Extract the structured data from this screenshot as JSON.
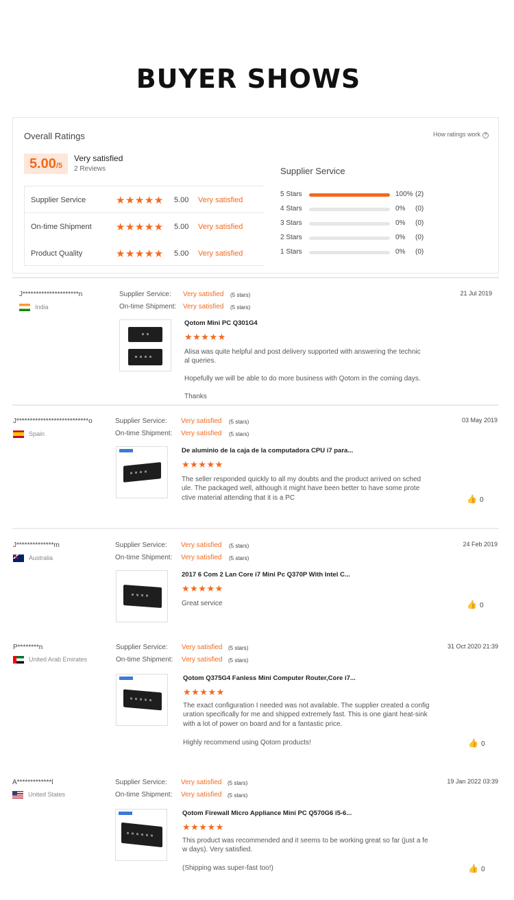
{
  "page": {
    "title": "BUYER SHOWS"
  },
  "summary": {
    "header": "Overall Ratings",
    "how_ratings_work": "How ratings work",
    "help_glyph": "?",
    "score": "5.00",
    "score_max": "/5",
    "rating_text": "Very satisfied",
    "reviews_count": "2 Reviews",
    "categories": [
      {
        "name": "Supplier Service",
        "stars": "★★★★★",
        "value": "5.00",
        "text": "Very satisfied"
      },
      {
        "name": "On-time Shipment",
        "stars": "★★★★★",
        "value": "5.00",
        "text": "Very satisfied"
      },
      {
        "name": "Product Quality",
        "stars": "★★★★★",
        "value": "5.00",
        "text": "Very satisfied"
      }
    ],
    "breakdown_title": "Supplier Service",
    "breakdown": [
      {
        "label": "5 Stars",
        "fraction": 1.0,
        "percent": "100%",
        "count": "(2)"
      },
      {
        "label": "4 Stars",
        "fraction": 0.0,
        "percent": "0%",
        "count": "(0)"
      },
      {
        "label": "3 Stars",
        "fraction": 0.0,
        "percent": "0%",
        "count": "(0)"
      },
      {
        "label": "2 Stars",
        "fraction": 0.0,
        "percent": "0%",
        "count": "(0)"
      },
      {
        "label": "1 Stars",
        "fraction": 0.0,
        "percent": "0%",
        "count": "(0)"
      }
    ],
    "accent_color": "#f26a1e"
  },
  "review_labels": {
    "supplier": "Supplier Service:",
    "shipment": "On-time Shipment:"
  },
  "reviews": [
    {
      "user": "J*********************n",
      "country": "India",
      "flag": "flag-india",
      "supplier_value": "Very satisfied",
      "supplier_stars": "(5 stars)",
      "shipment_value": "Very satisfied",
      "shipment_stars": "(5 stars)",
      "date": "21 Jul 2019",
      "product": "Qotom Mini PC Q301G4",
      "stars": "★★★★★",
      "text1": "Alisa was quite helpful and post delivery supported with answering the technic",
      "text2": "al queries.",
      "text3": "Hopefully we will be able to do more business with Qotom in the coming days.",
      "text4": "Thanks",
      "likes": ""
    },
    {
      "user": "J***************************o",
      "country": "Spain",
      "flag": "flag-spain",
      "supplier_value": "Very satisfied",
      "supplier_stars": "(5 stars)",
      "shipment_value": "Very satisfied",
      "shipment_stars": "(5 stars)",
      "date": "03 May 2019",
      "product": "De aluminio de la caja de la computadora CPU i7 para...",
      "stars": "★★★★★",
      "text1": "The seller responded quickly to all my doubts and the product arrived on sched",
      "text2": "ule. The packaged well, although it might have been better to have some prote",
      "text3": "ctive material attending that it is a PC",
      "likes": "0"
    },
    {
      "user": "J**************m",
      "country": "Australia",
      "flag": "flag-australia",
      "supplier_value": "Very satisfied",
      "supplier_stars": "(5 stars)",
      "shipment_value": "Very satisfied",
      "shipment_stars": "(5 stars)",
      "date": "24 Feb 2019",
      "product": "2017 6 Com 2 Lan Core i7 Mini Pc Q370P With Intel C...",
      "stars": "★★★★★",
      "text1": "Great service",
      "likes": "0"
    },
    {
      "user": "P********n",
      "country": "United Arab Emirates",
      "flag": "flag-uae",
      "supplier_value": "Very satisfied",
      "supplier_stars": "(5 stars)",
      "shipment_value": "Very satisfied",
      "shipment_stars": "(5 stars)",
      "date": "31 Oct 2020 21:39",
      "product": "Qotom Q375G4 Fanless Mini Computer Router,Core i7...",
      "stars": "★★★★★",
      "text1": "The exact configuration I needed was not available. The supplier created a config",
      "text2": "uration specifically for me and shipped extremely fast. This is one giant heat-sink",
      "text3": "with a lot of power on board and for a fantastic price.",
      "text4": "Highly recommend using Qotom products!",
      "likes": "0"
    },
    {
      "user": "A*************l",
      "country": "United States",
      "flag": "flag-us",
      "supplier_value": "Very satisfied",
      "supplier_stars": "(5 stars)",
      "shipment_value": "Very satisfied",
      "shipment_stars": "(5 stars)",
      "date": "19 Jan 2022 03:39",
      "product": "Qotom Firewall Micro Appliance Mini PC Q570G6 i5-6...",
      "stars": "★★★★★",
      "text1": "This product was recommended and it seems to be working great so far (just a fe",
      "text2": "w days). Very satisfied.",
      "text3": "(Shipping was super-fast too!)",
      "likes": "0"
    }
  ],
  "like_glyph": "👍"
}
